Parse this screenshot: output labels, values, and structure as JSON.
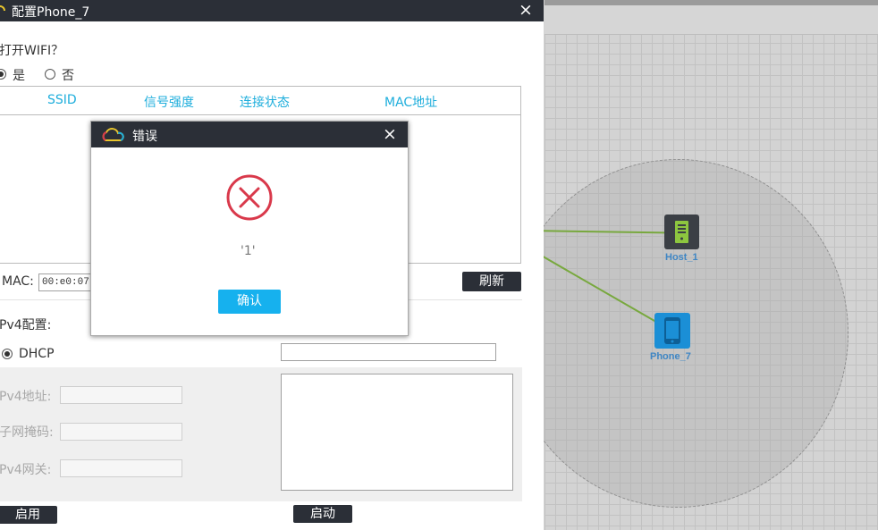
{
  "window": {
    "title": "配置Phone_7",
    "close_icon": "×"
  },
  "wifi": {
    "question": "打开WIFI？",
    "yes_label": "是",
    "no_label": "否",
    "yes_selected": true,
    "columns": [
      "SSID",
      "信号强度",
      "连接状态",
      "MAC地址"
    ]
  },
  "mac": {
    "label": "MAC:",
    "value": "00:e0:07:0",
    "refresh_label": "刷新"
  },
  "ipv4": {
    "section_label": "Pv4配置:",
    "dhcp_label": "DHCP",
    "dhcp_selected": true,
    "address_label": "Pv4地址:",
    "mask_label": "子网掩码:",
    "gateway_label": "Pv4网关:",
    "enable_label": "启用",
    "start_label": "启动"
  },
  "error_dialog": {
    "title": "错误",
    "message": "'1'",
    "ok_label": "确认",
    "close_icon": "×",
    "error_color": "#d9394b"
  },
  "canvas": {
    "nodes": [
      {
        "label": "Host_1",
        "type": "host-icon"
      },
      {
        "label": "Phone_7",
        "type": "phone-icon"
      }
    ],
    "link_color": "#78a83e",
    "label_color": "#3f86c4"
  }
}
